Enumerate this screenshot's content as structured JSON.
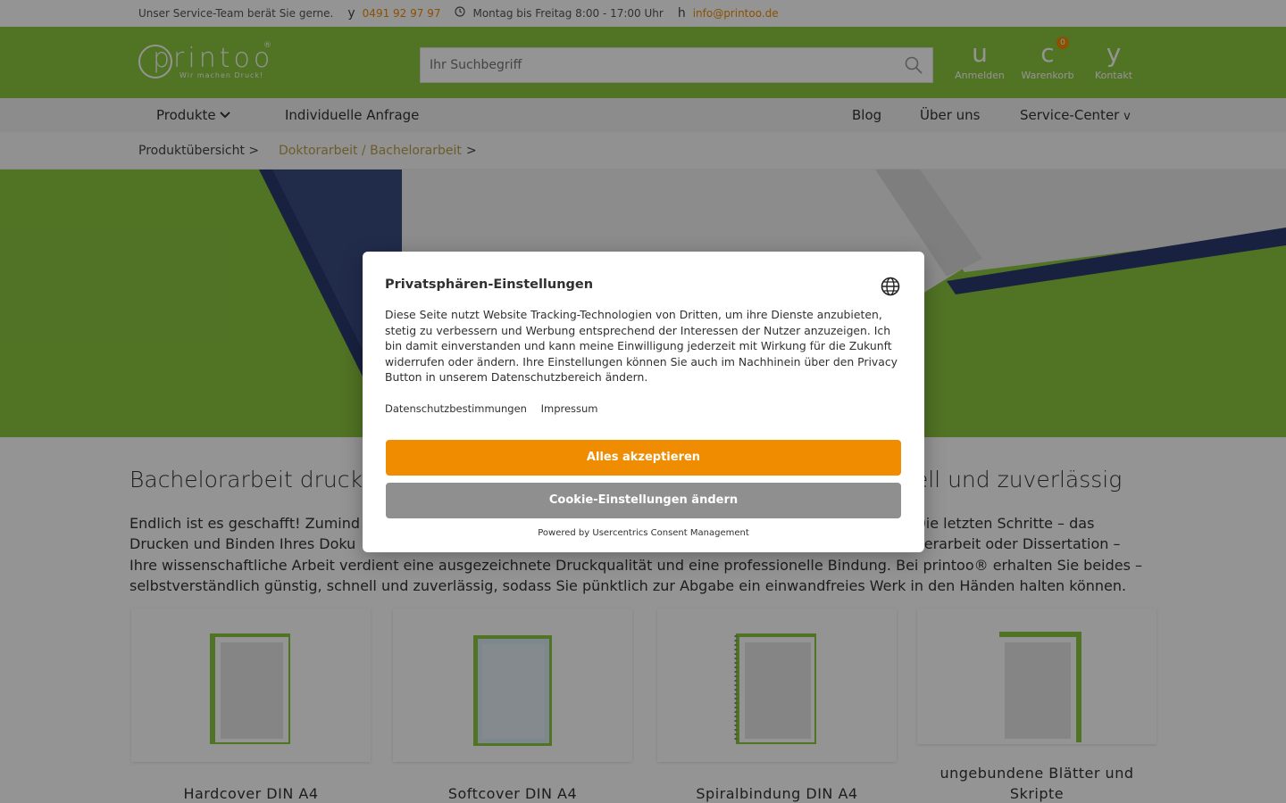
{
  "topbar": {
    "service_text": "Unser Service-Team berät Sie gerne.",
    "phone_icon": "y",
    "phone": "0491 92 97 97",
    "hours": "Montag bis Freitag 8:00 - 17:00 Uhr",
    "mail_icon": "h",
    "email": "info@printoo.de"
  },
  "header": {
    "logo_text": "printoo",
    "logo_reg": "®",
    "logo_tagline": "Wir machen Druck!",
    "search_placeholder": "Ihr Suchbegriff",
    "login": {
      "glyph": "u",
      "label": "Anmelden"
    },
    "cart": {
      "glyph": "c",
      "label": "Warenkorb",
      "count": "0"
    },
    "contact": {
      "glyph": "y",
      "label": "Kontakt"
    },
    "brand_color": "#8cc63f",
    "accent_color": "#f08c00"
  },
  "nav": {
    "products": "Produkte",
    "individual": "Individuelle Anfrage",
    "blog": "Blog",
    "about": "Über uns",
    "service": "Service-Center",
    "service_arrow": "v"
  },
  "breadcrumb": {
    "item1": "Produktübersicht >",
    "item2": "Doktorarbeit / Bachelorarbeit",
    "item2_sep": ">"
  },
  "content": {
    "title_left": "Bachelorarbeit drucke",
    "title_right": "nell und zuverlässig",
    "paragraph_line1": "Endlich ist es geschafft! Zumind",
    "paragraph_line1_end": "t. Die letzten Schritte – das",
    "paragraph_line2": "Drucken und Binden Ihres Doku",
    "paragraph_line2_end": "usterarbeit oder Dissertation –",
    "paragraph_line3": "Ihre wissenschaftliche Arbeit verdient eine ausgezeichnete Druckqualität und eine professionelle Bindung. Bei printoo® erhalten Sie beides –",
    "paragraph_line4": "selbstverständlich günstig, schnell und zuverlässig, sodass Sie pünktlich zur Abgabe ein einwandfreies Werk in den Händen halten können."
  },
  "cards": [
    {
      "label": "Hardcover DIN A4"
    },
    {
      "label": "Softcover DIN A4"
    },
    {
      "label": "Spiralbindung DIN A4"
    },
    {
      "label": "ungebundene Blätter und Skripte"
    }
  ],
  "consent": {
    "title": "Privatsphären-Einstellungen",
    "body": "Diese Seite nutzt Website Tracking-Technologien von Dritten, um ihre Dienste anzubieten, stetig zu verbessern und Werbung entsprechend der Interessen der Nutzer anzuzeigen. Ich bin damit einverstanden und kann meine Einwilligung jederzeit mit Wirkung für die Zukunft widerrufen oder ändern. Ihre Einstellungen können Sie auch im Nachhinein über den Privacy Button in unserem Datenschutzbereich ändern.",
    "link_privacy": "Datenschutzbestimmungen",
    "link_imprint": "Impressum",
    "accept_label": "Alles akzeptieren",
    "settings_label": "Cookie-Einstellungen ändern",
    "powered_by": "Powered by Usercentrics Consent Management",
    "accept_color": "#f08c00",
    "settings_color": "#8f8f8f"
  }
}
